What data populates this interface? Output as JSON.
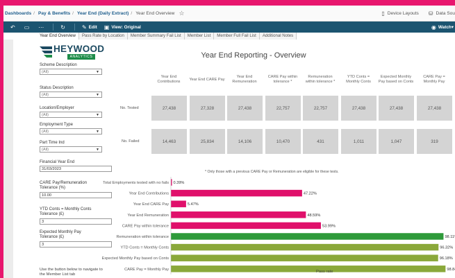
{
  "breadcrumb": {
    "items": [
      "Dashboards",
      "Pay & Benefits",
      "Year End (Daily Extract)",
      "Year End Overview"
    ],
    "separator": "/"
  },
  "top_right": {
    "device_layouts": "Device Layouts",
    "data_sources": "Data Sou"
  },
  "toolbar": {
    "edit": "Edit",
    "view": "View: Original",
    "watch": "Watch"
  },
  "tabs": [
    "Year End Overview",
    "Pass Rate by Location",
    "Member Summary Fail List",
    "Member List",
    "Member Full Fail List",
    "Additional Notes"
  ],
  "logo": {
    "wordmark": "HEYWOOD",
    "tag": "ANALYTICS"
  },
  "title": "Year End Reporting - Overview",
  "filters": {
    "scheme": {
      "label": "Scheme Description",
      "value": "(All)"
    },
    "status": {
      "label": "Status Description",
      "value": "(All)"
    },
    "location": {
      "label": "Location/Employer",
      "value": "(All)"
    },
    "emptype": {
      "label": "Employment Type",
      "value": "(All)"
    },
    "parttime": {
      "label": "Part Time Ind",
      "value": "(All)"
    },
    "fye": {
      "label": "Financial Year End",
      "value": "31/03/2023"
    },
    "care_tol": {
      "label1": "CARE Pay/Remuneration",
      "label2": "Tolerance (%)",
      "value": "10.00"
    },
    "ytd_tol": {
      "label1": "YTD Conts = Monthly Conts",
      "label2": "Tolerance (£)",
      "value": "3"
    },
    "emp_tol": {
      "label1": "Expected Monthly Pay",
      "label2": "Tolerance (£)",
      "value": "3"
    }
  },
  "nav_note": "Use the button below to navigate to the Member List tab",
  "table": {
    "columns": [
      [
        "Year End",
        "Contributions"
      ],
      [
        "Year End CARE Pay"
      ],
      [
        "Year End",
        "Remuneration"
      ],
      [
        "CARE Pay within",
        "tolerance *"
      ],
      [
        "Remuneration",
        "within tolerance *"
      ],
      [
        "YTD Conts =",
        "Monthly Conts"
      ],
      [
        "Expected Monthly",
        "Pay based on Conts"
      ],
      [
        "CARE Pay =",
        "Monthly Pay"
      ]
    ],
    "rows": [
      {
        "label": "No. Tested",
        "values": [
          "27,438",
          "27,328",
          "27,438",
          "22,757",
          "22,757",
          "27,438",
          "27,438",
          "27,438"
        ]
      },
      {
        "label": "No. Failed",
        "values": [
          "14,463",
          "25,834",
          "14,106",
          "10,470",
          "431",
          "1,011",
          "1,047",
          "319"
        ]
      }
    ],
    "footnote": "* Only those with a previous CARE Pay or Remuneration are eligible for these tests."
  },
  "chart_data": {
    "type": "bar",
    "orientation": "horizontal",
    "xlabel": "Pass rate",
    "categories": [
      "Total Employments tested with no fails",
      "Year End Contributions",
      "Year End CARE Pay",
      "Year End Remuneration",
      "CARE Pay within tolerance",
      "Remuneration within tolerance",
      "YTD Conts = Monthly Conts",
      "Expected Monthly Pay based on Conts",
      "CARE Pay = Monthly Pay"
    ],
    "values": [
      0.39,
      47.22,
      5.47,
      48.59,
      53.99,
      98.11,
      96.32,
      96.18,
      98.84
    ],
    "value_labels": [
      "0.39%",
      "47.22%",
      "5.47%",
      "48.59%",
      "53.99%",
      "98.11%",
      "96.32%",
      "96.18%",
      "98.84%"
    ],
    "colors": [
      "#e0106b",
      "#e0106b",
      "#e0106b",
      "#e0106b",
      "#e0106b",
      "#2e9a3a",
      "#8aa83a",
      "#8aa83a",
      "#8aa83a"
    ],
    "xlim": [
      0,
      100
    ]
  },
  "colors": {
    "frame": "#e8166e",
    "toolbar": "#1c5470",
    "fail": "#e0106b",
    "pass_high": "#2e9a3a",
    "pass_mid": "#8aa83a"
  }
}
